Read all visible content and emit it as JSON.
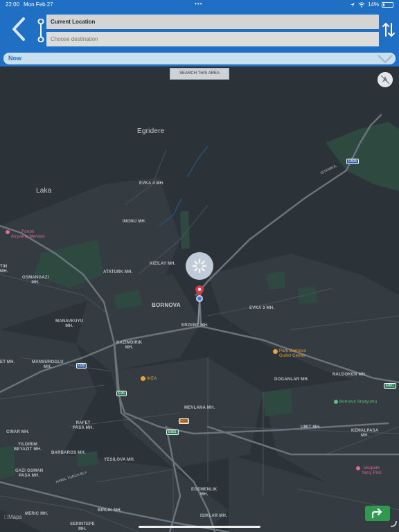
{
  "status_bar": {
    "time": "22:00",
    "date": "Mon Feb 27",
    "battery": "14%",
    "battery_level": 0.14
  },
  "header": {
    "origin_value": "Current Location",
    "destination_placeholder": "Choose destination"
  },
  "time_selector": {
    "label": "Now"
  },
  "map": {
    "search_area_label": "SEARCH THIS AREA",
    "attribution": "Maps",
    "labels": {
      "egridere": "Egridere",
      "laka": "Laka",
      "bornova": "BORNOVA",
      "evka4": "EVKA 4 MH.",
      "inonu": "INONU MH.",
      "kizilay": "KIZILAY MH.",
      "ataturk": "ATATURK MH.",
      "evka3": "EVKA 3 MH.",
      "erzene": "ERZENE MH.",
      "osmangazi": "OSMANGAZI\nMH.",
      "tin": "TIN\nMH.",
      "manavkuyu": "MANAVKUYU\nMH.",
      "kazimdirik": "KAZIMDIRIK\nMH.",
      "et": "ET MH.",
      "mansuroglu": "MANSUROGLU\nMH.",
      "doganlar": "DOGANLAR MH.",
      "naldoken": "NALDOKEN MH.",
      "mevlana": "MEVLANA MH.",
      "rafet_pasa": "RAFET\nPASA MH.",
      "cinar": "CINAR MH.",
      "umit": "UMIT MH.",
      "kemalpasa": "KEMALPASA\nMH.",
      "yildirim_beyazit": "YILDIRIM\nBEYAZIT MH.",
      "barbaros": "BARBAROS MH.",
      "yesilova": "YESILOVA MH.",
      "gazi_osman_pasa": "GAZI OSMAN\nPASA MH.",
      "egemenlik": "EGEMENLIK\nMH.",
      "meric": "MERIC MH.",
      "birlik": "BIRLIK MH.",
      "isiklar": "ISIKLAR MH.",
      "serintepe": "SERINTEPE\nMH.",
      "road_istanbul": "ISTANBUL",
      "road_kamil": "KAMIL TUNCA BLV."
    },
    "pois": {
      "ikea": "IKEA",
      "park_bornova": "Park Bornova\nOutlet Center",
      "bornova_stadyumu": "Bornova Stadyumu",
      "ukupark": "Ukupark\nYarış Pisti",
      "forum": "Forum\nAlışveriş Merkezi"
    },
    "shields": {
      "d505": "D505",
      "o30": "O30",
      "e96": "E96",
      "e881_left": "E881",
      "e881_right": "E881",
      "o33": "O33"
    }
  },
  "colors": {
    "header_blue": "#1f6fc4",
    "map_bg": "#2b3238",
    "pin_red": "#d43a4a",
    "go_green": "#2f9a4f"
  }
}
